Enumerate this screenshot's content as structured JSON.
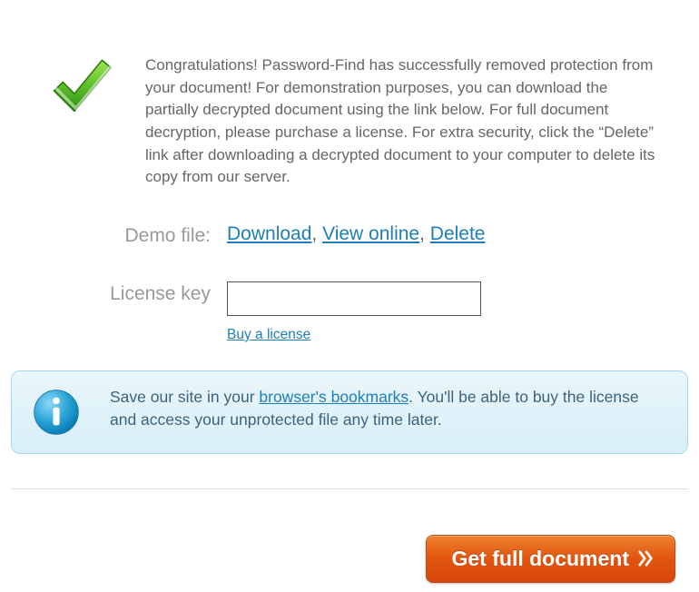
{
  "congrats_text": "Congratulations! Password-Find has successfully removed protection from your document! For demonstration purposes, you can download the partially decrypted document using the link below. For full document decryption, please purchase a license. For extra security, click the “Delete” link after downloading a decrypted document to your computer to delete its copy from our server.",
  "demo": {
    "label": "Demo file:",
    "download": "Download",
    "view_online": "View online",
    "delete": "Delete",
    "sep": ", "
  },
  "license": {
    "label": "License key",
    "value": "",
    "buy_link": "Buy a license"
  },
  "info": {
    "prefix": "Save our site in your ",
    "link_text": "browser's bookmarks",
    "suffix": ". You'll be able to buy the license and access your unprotected file any time later."
  },
  "cta": {
    "label": "Get full document"
  },
  "colors": {
    "link": "#1e7fb8",
    "cta_bg_top": "#ef812f",
    "cta_bg_bottom": "#d8470b",
    "info_bg_top": "#eaf6fb",
    "info_bg_bottom": "#d7eff8",
    "info_border": "#a7d9ec"
  }
}
